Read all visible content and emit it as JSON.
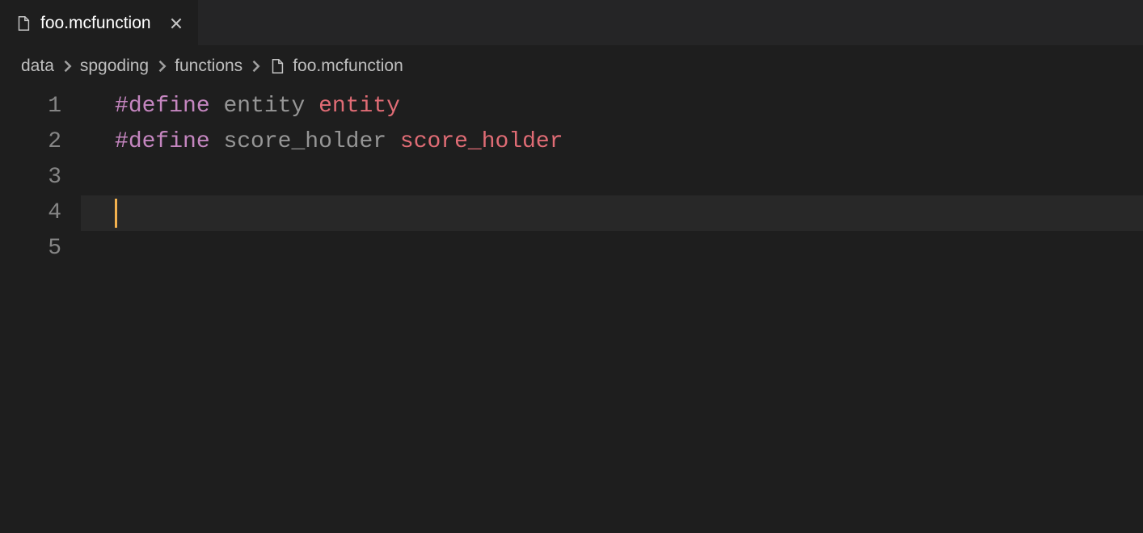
{
  "tab": {
    "label": "foo.mcfunction",
    "icon_name": "file-icon"
  },
  "breadcrumb": {
    "items": [
      {
        "label": "data"
      },
      {
        "label": "spgoding"
      },
      {
        "label": "functions"
      },
      {
        "label": "foo.mcfunction",
        "has_icon": true
      }
    ]
  },
  "editor": {
    "lines": [
      {
        "num": "1",
        "tokens": [
          {
            "cls": "tok-hash",
            "text": "#"
          },
          {
            "cls": "tok-directive",
            "text": "define"
          },
          {
            "cls": "",
            "text": " "
          },
          {
            "cls": "tok-type",
            "text": "entity"
          },
          {
            "cls": "",
            "text": " "
          },
          {
            "cls": "tok-entity",
            "text": "entity"
          }
        ]
      },
      {
        "num": "2",
        "tokens": [
          {
            "cls": "tok-hash",
            "text": "#"
          },
          {
            "cls": "tok-directive",
            "text": "define"
          },
          {
            "cls": "",
            "text": " "
          },
          {
            "cls": "tok-type",
            "text": "score_holder"
          },
          {
            "cls": "",
            "text": " "
          },
          {
            "cls": "tok-entity",
            "text": "score_holder"
          }
        ]
      },
      {
        "num": "3",
        "tokens": []
      },
      {
        "num": "4",
        "tokens": [],
        "current": true
      },
      {
        "num": "5",
        "tokens": []
      }
    ]
  }
}
